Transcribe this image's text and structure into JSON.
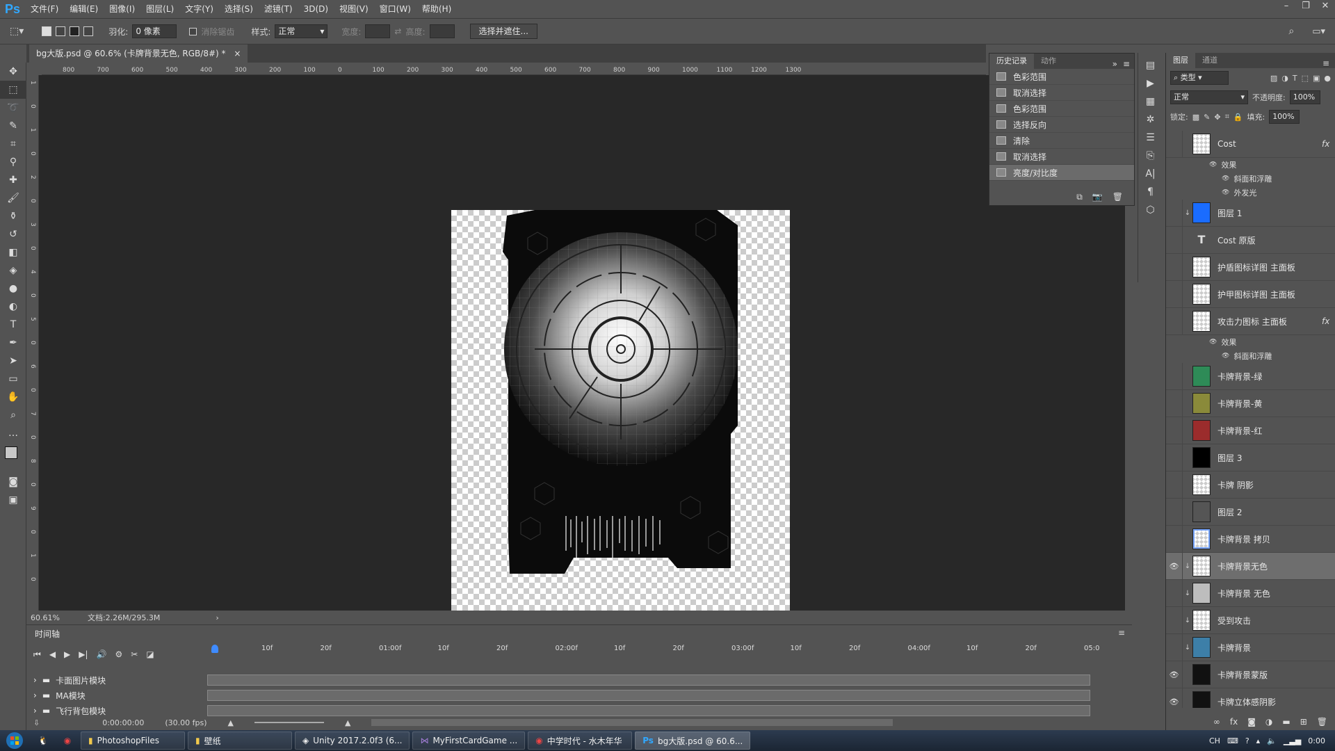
{
  "app": {
    "logo": "Ps",
    "menus": [
      "文件(F)",
      "编辑(E)",
      "图像(I)",
      "图层(L)",
      "文字(Y)",
      "选择(S)",
      "滤镜(T)",
      "3D(D)",
      "视图(V)",
      "窗口(W)",
      "帮助(H)"
    ]
  },
  "options": {
    "feather_label": "羽化:",
    "feather_value": "0 像素",
    "antialias": "消除锯齿",
    "style_label": "样式:",
    "style_value": "正常",
    "width_label": "宽度:",
    "height_label": "高度:",
    "select_mask_button": "选择并遮住..."
  },
  "document": {
    "tab_title": "bg大版.psd @ 60.6% (卡牌背景无色, RGB/8#) *",
    "zoom": "60.61%",
    "doc_size": "文档:2.26M/295.3M"
  },
  "rulers": {
    "top": [
      "800",
      "700",
      "600",
      "500",
      "400",
      "300",
      "200",
      "100",
      "0",
      "100",
      "200",
      "300",
      "400",
      "500",
      "600",
      "700",
      "800",
      "900",
      "1000",
      "1100",
      "1200",
      "1300"
    ],
    "left": [
      "1",
      "0",
      "1",
      "0",
      "2",
      "0",
      "3",
      "0",
      "4",
      "0",
      "5",
      "0",
      "6",
      "0",
      "7",
      "0",
      "8",
      "0",
      "9",
      "0",
      "1",
      "0"
    ]
  },
  "history": {
    "tabs": [
      "历史记录",
      "动作"
    ],
    "items": [
      "色彩范围",
      "取消选择",
      "色彩范围",
      "选择反向",
      "清除",
      "取消选择",
      "亮度/对比度"
    ],
    "selected_index": 6
  },
  "layers": {
    "tabs": [
      "图层",
      "通道"
    ],
    "filter_kind": "类型",
    "blend_mode": "正常",
    "opacity_label": "不透明度:",
    "opacity_value": "100%",
    "lock_label": "锁定:",
    "fill_label": "填充:",
    "fill_value": "100%",
    "items": [
      {
        "name": "Cost",
        "fx": "fx",
        "thumb": "checker",
        "visible": false,
        "effects": [
          "效果",
          "斜面和浮雕",
          "外发光"
        ]
      },
      {
        "name": "图层 1",
        "thumb": "#1a6cff",
        "clip": true,
        "visible": false
      },
      {
        "name": "Cost 原版",
        "thumb": "text",
        "visible": false
      },
      {
        "name": "护盾图标详图 主面板",
        "thumb": "checker",
        "visible": false
      },
      {
        "name": "护甲图标详图 主面板",
        "thumb": "checker",
        "visible": false
      },
      {
        "name": "攻击力图标 主面板",
        "fx": "fx",
        "thumb": "checker",
        "visible": false,
        "effects": [
          "效果",
          "斜面和浮雕"
        ]
      },
      {
        "name": "卡牌背景-绿",
        "thumb": "#2e8b57",
        "visible": false
      },
      {
        "name": "卡牌背景-黄",
        "thumb": "#8a8a3a",
        "visible": false
      },
      {
        "name": "卡牌背景-红",
        "thumb": "#9b2c2c",
        "visible": false
      },
      {
        "name": "图层 3",
        "thumb": "#000000",
        "visible": false
      },
      {
        "name": "卡牌 阴影",
        "thumb": "checker",
        "visible": false
      },
      {
        "name": "图层 2",
        "thumb": "#555555",
        "visible": false
      },
      {
        "name": "卡牌背景 拷贝",
        "thumb": "checker-blue",
        "visible": false
      },
      {
        "name": "卡牌背景无色",
        "thumb": "checker",
        "clip": true,
        "visible": true,
        "selected": true
      },
      {
        "name": "卡牌背景 无色",
        "thumb": "#bdbdbd",
        "clip": true,
        "visible": false
      },
      {
        "name": "受到攻击",
        "thumb": "checker",
        "clip": true,
        "visible": false
      },
      {
        "name": "卡牌背景",
        "thumb": "#3d7fa8",
        "clip": true,
        "visible": false
      },
      {
        "name": "卡牌背景蒙版",
        "thumb": "#111111",
        "visible": true
      },
      {
        "name": "卡牌立体感阴影",
        "thumb": "#111111",
        "visible": true
      }
    ]
  },
  "timeline": {
    "title": "时间轴",
    "ruler": [
      "10f",
      "20f",
      "01:00f",
      "10f",
      "20f",
      "02:00f",
      "10f",
      "20f",
      "03:00f",
      "10f",
      "20f",
      "04:00f",
      "10f",
      "20f",
      "05:0"
    ],
    "tracks": [
      "卡面图片模块",
      "MA模块",
      "飞行背包模块"
    ],
    "time": "0:00:00:00",
    "fps": "(30.00 fps)"
  },
  "taskbar": {
    "items": [
      "PhotoshopFiles",
      "壁纸",
      "Unity 2017.2.0f3 (6...",
      "MyFirstCardGame ...",
      "中学时代 - 水木年华",
      "bg大版.psd @ 60.6..."
    ],
    "active_index": 5,
    "lang": "CH",
    "clock": "0:00"
  }
}
